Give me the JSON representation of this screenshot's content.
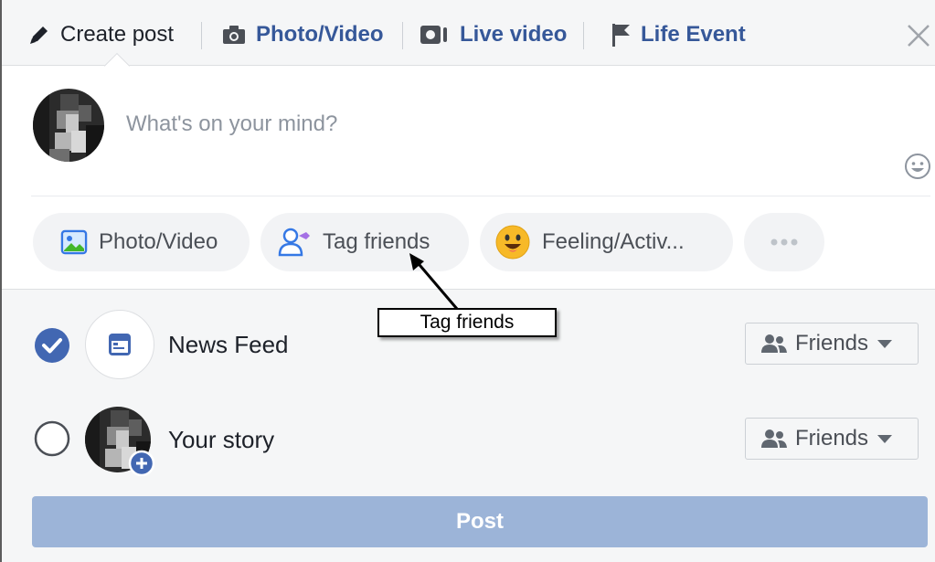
{
  "header": {
    "tabs": [
      {
        "label": "Create post",
        "icon": "pencil-icon"
      },
      {
        "label": "Photo/Video",
        "icon": "camera-icon"
      },
      {
        "label": "Live video",
        "icon": "video-camera-icon"
      },
      {
        "label": "Life Event",
        "icon": "flag-icon"
      }
    ],
    "close_icon": "close-icon"
  },
  "composer": {
    "placeholder": "What's on your mind?",
    "emoji_icon": "smiley-icon"
  },
  "chips": [
    {
      "label": "Photo/Video",
      "icon": "photo-icon"
    },
    {
      "label": "Tag friends",
      "icon": "tag-friends-icon"
    },
    {
      "label": "Feeling/Activ...",
      "icon": "feeling-emoji-icon"
    },
    {
      "label": "",
      "icon": "more-icon"
    }
  ],
  "annotation": {
    "text": "Tag friends"
  },
  "share_rows": [
    {
      "label": "News Feed",
      "checked": true,
      "audience": "Friends"
    },
    {
      "label": "Your story",
      "checked": false,
      "audience": "Friends"
    }
  ],
  "post_button": {
    "label": "Post"
  },
  "colors": {
    "link": "#365899",
    "brand_blue": "#4267b2",
    "post_button_disabled": "#9cb4d8",
    "header_bg": "#f5f6f7"
  }
}
